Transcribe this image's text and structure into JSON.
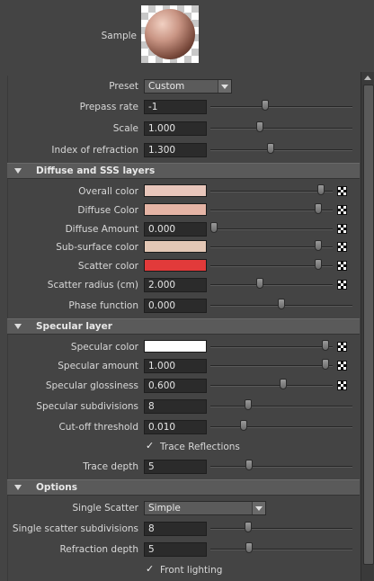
{
  "sample": {
    "label": "Sample"
  },
  "top": {
    "preset": {
      "label": "Preset",
      "value": "Custom"
    },
    "prepass_rate": {
      "label": "Prepass rate",
      "value": "-1",
      "slider": 0.38
    },
    "scale": {
      "label": "Scale",
      "value": "1.000",
      "slider": 0.34
    },
    "ior": {
      "label": "Index of refraction",
      "value": "1.300",
      "slider": 0.42
    }
  },
  "diffuse": {
    "title": "Diffuse and SSS layers",
    "overall_color": {
      "label": "Overall color",
      "color": "#e8c6bb",
      "slider": 0.93
    },
    "diffuse_color": {
      "label": "Diffuse Color",
      "color": "#e5b4a5",
      "slider": 0.91
    },
    "diffuse_amount": {
      "label": "Diffuse Amount",
      "value": "0.000",
      "slider": 0.0
    },
    "subsurface_color": {
      "label": "Sub-surface color",
      "color": "#e3c7b5",
      "slider": 0.91
    },
    "scatter_color": {
      "label": "Scatter color",
      "color": "#e23a3a",
      "slider": 0.91
    },
    "scatter_radius": {
      "label": "Scatter radius (cm)",
      "value": "2.000",
      "slider": 0.4
    },
    "phase_function": {
      "label": "Phase function",
      "value": "0.000",
      "slider": 0.5
    }
  },
  "specular": {
    "title": "Specular layer",
    "specular_color": {
      "label": "Specular color",
      "color": "#ffffff",
      "slider": 0.97
    },
    "specular_amount": {
      "label": "Specular amount",
      "value": "1.000",
      "slider": 0.97
    },
    "specular_glossiness": {
      "label": "Specular glossiness",
      "value": "0.600",
      "slider": 0.6
    },
    "specular_subdivisions": {
      "label": "Specular subdivisions",
      "value": "8",
      "slider": 0.25
    },
    "cutoff_threshold": {
      "label": "Cut-off threshold",
      "value": "0.010",
      "slider": 0.22
    },
    "trace_reflections": {
      "label": "Trace Reflections",
      "checked": true
    },
    "trace_depth": {
      "label": "Trace depth",
      "value": "5",
      "slider": 0.26
    }
  },
  "options": {
    "title": "Options",
    "single_scatter": {
      "label": "Single Scatter",
      "value": "Simple"
    },
    "single_scatter_subdivisions": {
      "label": "Single scatter subdivisions",
      "value": "8",
      "slider": 0.25
    },
    "refraction_depth": {
      "label": "Refraction depth",
      "value": "5",
      "slider": 0.26
    },
    "front_lighting": {
      "label": "Front lighting",
      "checked": true
    }
  },
  "checkmark": "✓"
}
